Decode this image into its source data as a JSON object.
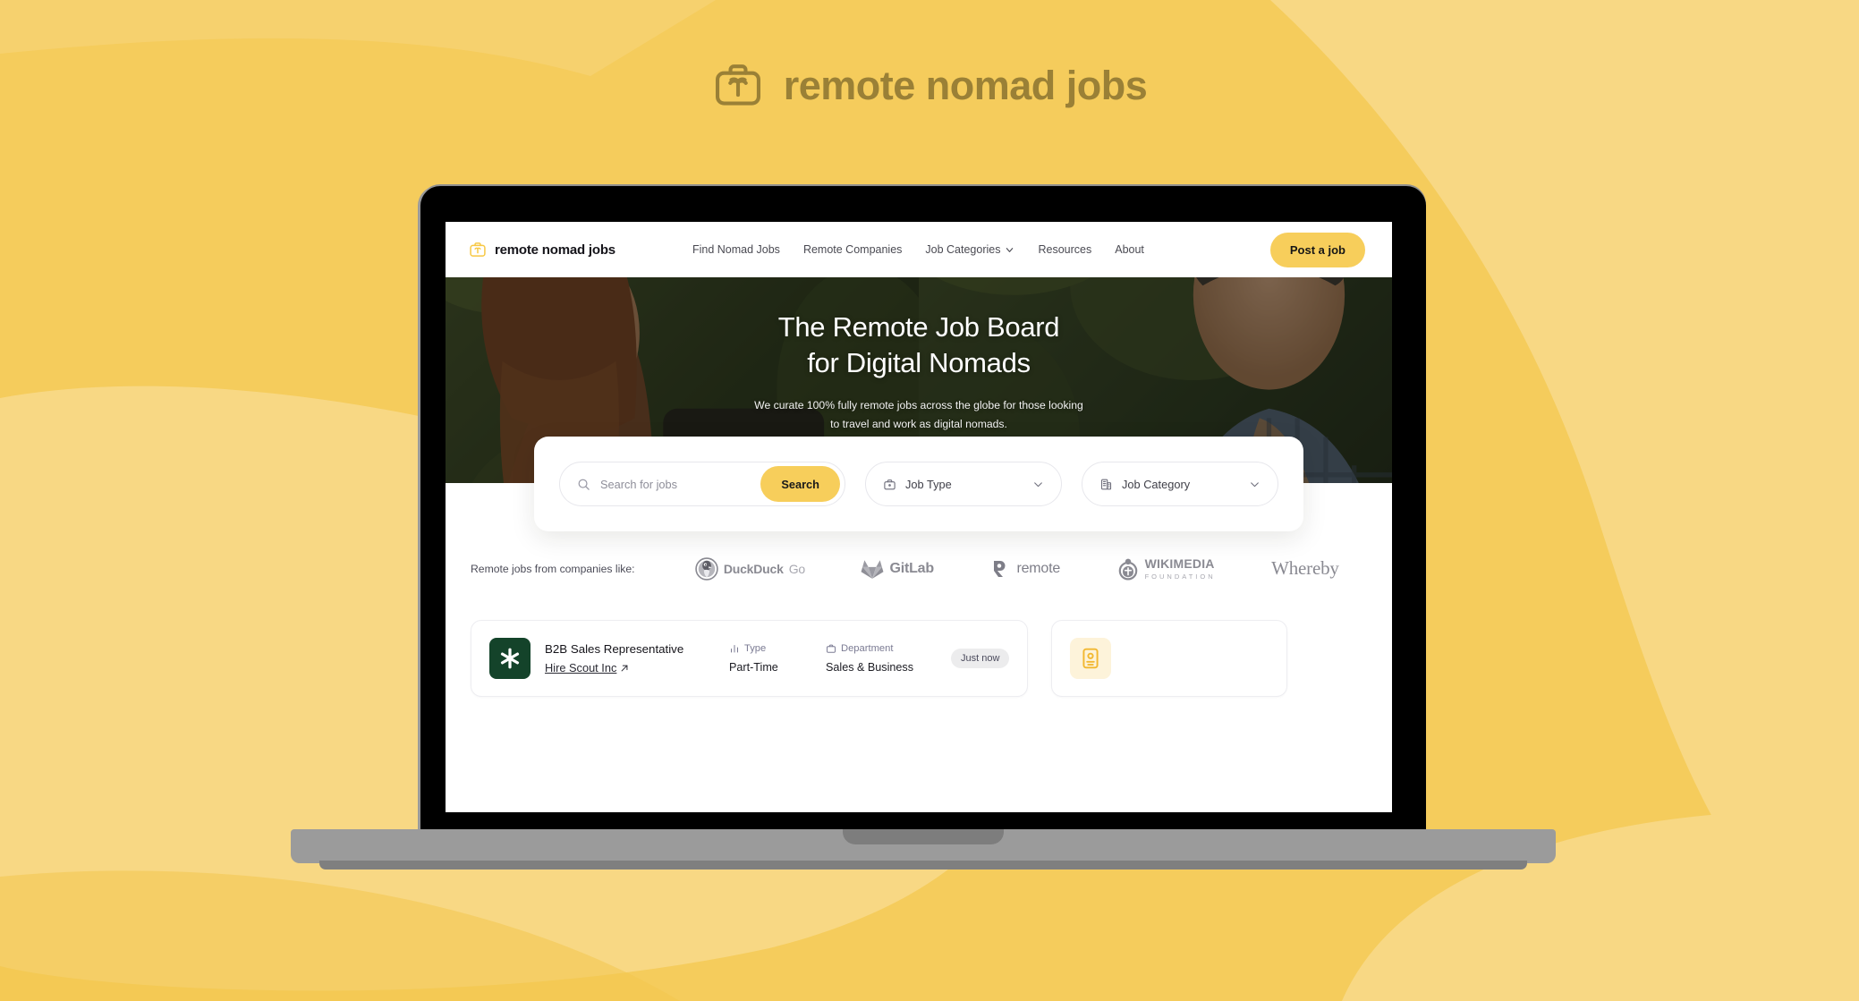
{
  "page": {
    "title": "remote nomad jobs",
    "title_icon": "briefcase-palm-icon",
    "background_color": "#F5CC5C",
    "background_accent_color": "#F8D884",
    "accent_color": "#F7CE5B"
  },
  "site": {
    "brand": {
      "name": "remote nomad jobs",
      "icon": "briefcase-palm-icon"
    },
    "nav": [
      {
        "label": "Find Nomad Jobs",
        "has_chevron": false
      },
      {
        "label": "Remote Companies",
        "has_chevron": false
      },
      {
        "label": "Job Categories",
        "has_chevron": true
      },
      {
        "label": "Resources",
        "has_chevron": false
      },
      {
        "label": "About",
        "has_chevron": false
      }
    ],
    "cta": {
      "label": "Post a job"
    }
  },
  "hero": {
    "title_line1": "The Remote Job Board",
    "title_line2": "for Digital Nomads",
    "subtitle_line1": "We curate 100% fully remote jobs across the globe for those looking",
    "subtitle_line2": "to travel and work as digital nomads."
  },
  "search": {
    "placeholder": "Search for jobs",
    "value": "",
    "button_label": "Search",
    "filters": [
      {
        "label": "Job Type",
        "icon": "briefcase-icon"
      },
      {
        "label": "Job Category",
        "icon": "building-icon"
      }
    ]
  },
  "logos": {
    "label": "Remote jobs from companies like:",
    "companies": [
      {
        "name": "DuckDuckGo",
        "word_dark": "DuckDuck",
        "word_light": "Go",
        "icon": "duckduckgo-icon"
      },
      {
        "name": "GitLab",
        "word_dark": "GitLab",
        "word_light": "",
        "icon": "gitlab-icon"
      },
      {
        "name": "remote",
        "word_dark": "remote",
        "word_light": "",
        "icon": "remote-icon"
      },
      {
        "name": "Wikimedia Foundation",
        "word_dark": "WIKIMEDIA",
        "word_light": "FOUNDATION",
        "icon": "wikimedia-icon"
      },
      {
        "name": "Whereby",
        "word_dark": "Whereby",
        "word_light": "",
        "icon": "whereby-wordmark"
      }
    ]
  },
  "jobs": {
    "columns": {
      "type": "Type",
      "department": "Department"
    },
    "items": [
      {
        "title": "B2B Sales Representative",
        "company": "Hire Scout Inc",
        "type": "Part-Time",
        "department": "Sales & Business",
        "posted": "Just now",
        "logo_letter": "*",
        "logo_color": "#14432A"
      }
    ],
    "placeholder_card": {
      "icon": "id-badge-icon"
    }
  }
}
